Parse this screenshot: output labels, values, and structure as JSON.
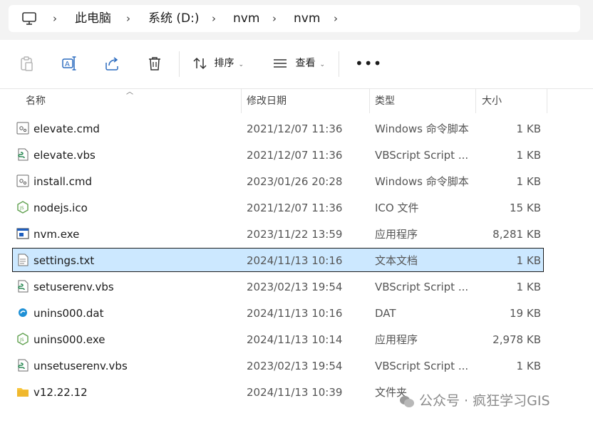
{
  "breadcrumb": [
    "此电脑",
    "系统 (D:)",
    "nvm",
    "nvm"
  ],
  "toolbar": {
    "sort_label": "排序",
    "view_label": "查看"
  },
  "columns": {
    "name": "名称",
    "date": "修改日期",
    "type": "类型",
    "size": "大小"
  },
  "files": [
    {
      "name": "elevate.cmd",
      "date": "2021/12/07 11:36",
      "type": "Windows 命令脚本",
      "size": "1 KB",
      "icon": "cmd-file-icon"
    },
    {
      "name": "elevate.vbs",
      "date": "2021/12/07 11:36",
      "type": "VBScript Script ...",
      "size": "1 KB",
      "icon": "vbs-file-icon"
    },
    {
      "name": "install.cmd",
      "date": "2023/01/26 20:28",
      "type": "Windows 命令脚本",
      "size": "1 KB",
      "icon": "cmd-file-icon"
    },
    {
      "name": "nodejs.ico",
      "date": "2021/12/07 11:36",
      "type": "ICO 文件",
      "size": "15 KB",
      "icon": "nodejs-icon"
    },
    {
      "name": "nvm.exe",
      "date": "2023/11/22 13:59",
      "type": "应用程序",
      "size": "8,281 KB",
      "icon": "exe-file-icon"
    },
    {
      "name": "settings.txt",
      "date": "2024/11/13 10:16",
      "type": "文本文档",
      "size": "1 KB",
      "icon": "txt-file-icon",
      "selected": true
    },
    {
      "name": "setuserenv.vbs",
      "date": "2023/02/13 19:54",
      "type": "VBScript Script ...",
      "size": "1 KB",
      "icon": "vbs-file-icon"
    },
    {
      "name": "unins000.dat",
      "date": "2024/11/13 10:16",
      "type": "DAT",
      "size": "19 KB",
      "icon": "dat-file-icon"
    },
    {
      "name": "unins000.exe",
      "date": "2024/11/13 10:14",
      "type": "应用程序",
      "size": "2,978 KB",
      "icon": "nodejs-icon"
    },
    {
      "name": "unsetuserenv.vbs",
      "date": "2023/02/13 19:54",
      "type": "VBScript Script ...",
      "size": "1 KB",
      "icon": "vbs-file-icon"
    },
    {
      "name": "v12.22.12",
      "date": "2024/11/13 10:39",
      "type": "文件夹",
      "size": "",
      "icon": "folder-icon"
    }
  ],
  "watermark": "公众号 · 疯狂学习GIS",
  "colors": {
    "selection_bg": "#cce8ff",
    "nav_bg": "#f3f3f3",
    "folder": "#f8c53a",
    "node_green": "#5fa04e"
  }
}
